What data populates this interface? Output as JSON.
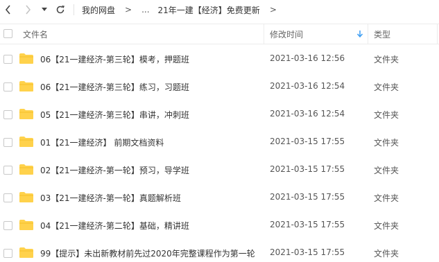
{
  "breadcrumb": {
    "root": "我的网盘",
    "ellipsis": "...",
    "current": "21年一建【经济】免费更新",
    "separator": ">"
  },
  "table": {
    "col_name": "文件名",
    "col_time": "修改时间",
    "col_type": "类型",
    "sort_color": "#3b9cf2",
    "folder_color": "#ffd24c",
    "rows": [
      {
        "name": "06【21一建经济-第三轮】模考，押题班",
        "time": "2021-03-16 12:56",
        "type": "文件夹"
      },
      {
        "name": "06【21一建经济-第三轮】练习，习题班",
        "time": "2021-03-16 12:54",
        "type": "文件夹"
      },
      {
        "name": "05【21一建经济-第三轮】串讲，冲刺班",
        "time": "2021-03-16 12:54",
        "type": "文件夹"
      },
      {
        "name": "01【21一建经济】 前期文档资料",
        "time": "2021-03-15 17:55",
        "type": "文件夹"
      },
      {
        "name": "02【21一建经济-第一轮】预习，导学班",
        "time": "2021-03-15 17:55",
        "type": "文件夹"
      },
      {
        "name": "03【21一建经济-第一轮】真题解析班",
        "time": "2021-03-15 17:55",
        "type": "文件夹"
      },
      {
        "name": "04【21一建经济-第二轮】基础，精讲班",
        "time": "2021-03-15 17:55",
        "type": "文件夹"
      },
      {
        "name": "99【提示】未出新教材前先过2020年完整课程作为第一轮",
        "time": "2021-03-15 17:55",
        "type": "文件夹"
      }
    ]
  }
}
